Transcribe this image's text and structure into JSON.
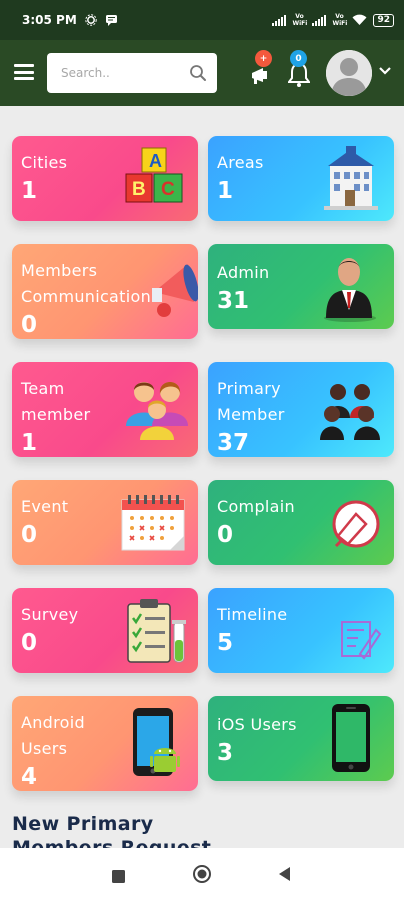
{
  "status_bar": {
    "time": "3:05 PM",
    "net1": "Vo WiFi",
    "net2": "Vo WiFi",
    "battery": "92"
  },
  "header": {
    "search_placeholder": "Search..",
    "megaphone_badge": "+",
    "bell_badge": "0"
  },
  "cards": [
    {
      "label": "Cities",
      "value": "1",
      "icon": "abc-blocks-icon"
    },
    {
      "label": "Areas",
      "value": "1",
      "icon": "building-icon"
    },
    {
      "label": "Members Communication",
      "label_line1": "Members",
      "label_line2": "Communication",
      "value": "0",
      "icon": "megaphone-icon"
    },
    {
      "label": "Admin",
      "value": "31",
      "icon": "businessman-icon"
    },
    {
      "label": "Team member",
      "label_line1": "Team",
      "label_line2": "member",
      "value": "1",
      "icon": "team-icon"
    },
    {
      "label": "Primary Member",
      "label_line1": "Primary",
      "label_line2": "Member",
      "value": "37",
      "icon": "group-icon"
    },
    {
      "label": "Event",
      "value": "0",
      "icon": "calendar-icon"
    },
    {
      "label": "Complain",
      "value": "0",
      "icon": "complain-icon"
    },
    {
      "label": "Survey",
      "value": "0",
      "icon": "clipboard-icon"
    },
    {
      "label": "Timeline",
      "value": "5",
      "icon": "timeline-icon"
    },
    {
      "label": "Android Users",
      "label_line1": "Android",
      "label_line2": "Users",
      "value": "4",
      "icon": "android-phone-icon"
    },
    {
      "label": "iOS Users",
      "value": "3",
      "icon": "iphone-icon"
    }
  ],
  "section": {
    "title": "New Primary Members Request"
  },
  "colors": {
    "status_bar": "#1f3a1f",
    "app_bar": "#2a4a25",
    "badge_red": "#f4593d",
    "badge_blue": "#1fa3e6",
    "pink": "#f94a8b",
    "orange": "#ff9572",
    "blue": "#38c3ff",
    "green": "#30c072",
    "section_title": "#1a2b4a"
  }
}
